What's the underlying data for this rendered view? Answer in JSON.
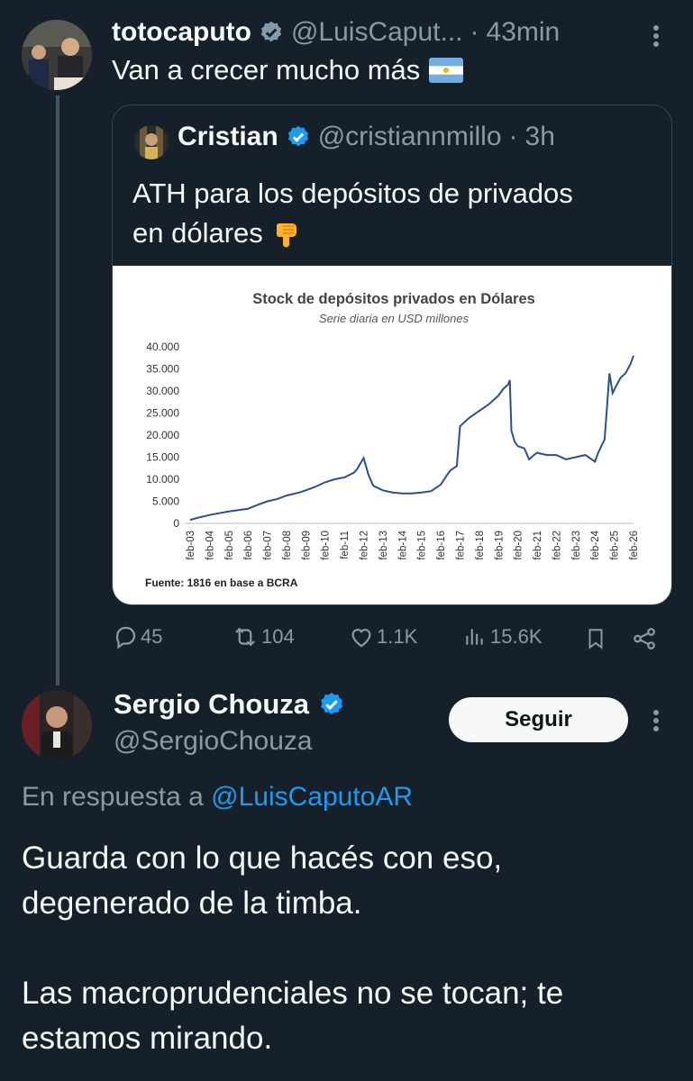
{
  "tweet1": {
    "display_name": "totocaputo",
    "handle": "@LuisCaput...",
    "dot": "·",
    "time": "43min",
    "text": "Van a crecer mucho más",
    "flag_emoji": "flag-argentina"
  },
  "quote": {
    "display_name": "Cristian",
    "handle": "@cristiannmillo",
    "dot": "·",
    "time": "3h",
    "text_line1": "ATH para los depósitos de privados",
    "text_line2": "en dólares",
    "emoji": "pointing-down"
  },
  "chart_data": {
    "type": "line",
    "title": "Stock de depósitos privados en Dólares",
    "subtitle": "Serie diaria en USD millones",
    "source": "Fuente: 1816 en base a BCRA",
    "yticks": [
      "40.000",
      "35.000",
      "30.000",
      "25.000",
      "20.000",
      "15.000",
      "10.000",
      "5.000",
      "0"
    ],
    "ylim": [
      0,
      40000
    ],
    "xticks": [
      "feb-03",
      "feb-04",
      "feb-05",
      "feb-06",
      "feb-07",
      "feb-08",
      "feb-09",
      "feb-10",
      "feb-11",
      "feb-12",
      "feb-13",
      "feb-14",
      "feb-15",
      "feb-16",
      "feb-17",
      "feb-18",
      "feb-19",
      "feb-20",
      "feb-21",
      "feb-22",
      "feb-23",
      "feb-24",
      "feb-25",
      "feb-26"
    ],
    "x": [
      "2003-02",
      "2003-06",
      "2004-02",
      "2004-08",
      "2005-02",
      "2005-08",
      "2006-02",
      "2006-08",
      "2007-02",
      "2007-08",
      "2008-02",
      "2008-10",
      "2009-02",
      "2009-08",
      "2010-02",
      "2010-08",
      "2011-02",
      "2011-08",
      "2011-10",
      "2011-11",
      "2012-02",
      "2012-05",
      "2012-08",
      "2013-02",
      "2013-08",
      "2014-02",
      "2014-08",
      "2015-02",
      "2015-08",
      "2016-02",
      "2016-06",
      "2016-08",
      "2016-12",
      "2017-02",
      "2017-08",
      "2018-02",
      "2018-08",
      "2019-02",
      "2019-05",
      "2019-08",
      "2019-09",
      "2019-10",
      "2019-12",
      "2020-02",
      "2020-06",
      "2020-09",
      "2020-12",
      "2021-02",
      "2021-08",
      "2022-02",
      "2022-08",
      "2023-02",
      "2023-08",
      "2024-02",
      "2024-04",
      "2024-06",
      "2024-08",
      "2024-09",
      "2024-11",
      "2025-01",
      "2025-03",
      "2025-06",
      "2025-09",
      "2025-12",
      "2026-02"
    ],
    "values": [
      800,
      1200,
      1900,
      2300,
      2700,
      3000,
      3300,
      4200,
      5000,
      5500,
      6300,
      7000,
      7500,
      8300,
      9300,
      10000,
      10400,
      11500,
      12300,
      13000,
      14800,
      11000,
      8500,
      7500,
      7000,
      6800,
      6800,
      7000,
      7300,
      8800,
      11000,
      12000,
      13000,
      22000,
      24000,
      25500,
      27000,
      29000,
      30500,
      31500,
      32500,
      21000,
      18500,
      17500,
      17000,
      14500,
      15500,
      16000,
      15500,
      15500,
      14500,
      15000,
      15500,
      14000,
      16000,
      17500,
      19000,
      24000,
      34000,
      29500,
      31000,
      33000,
      34000,
      36000,
      38000
    ]
  },
  "actions": {
    "replies": "45",
    "reposts": "104",
    "likes": "1.1K",
    "views": "15.6K"
  },
  "tweet2": {
    "display_name": "Sergio Chouza",
    "handle": "@SergioChouza",
    "follow_label": "Seguir",
    "reply_prefix": "En respuesta a",
    "reply_to": "@LuisCaputoAR",
    "text_line1": "Guarda con lo que hacés con eso,",
    "text_line2": "degenerado de la timba.",
    "text_line3": "Las macroprudenciales no se tocan; te",
    "text_line4": "estamos mirando."
  },
  "colors": {
    "background": "#15202b",
    "accent": "#1d9bf0",
    "muted": "#8b98a5",
    "chart_line": "#2e4f8f"
  }
}
